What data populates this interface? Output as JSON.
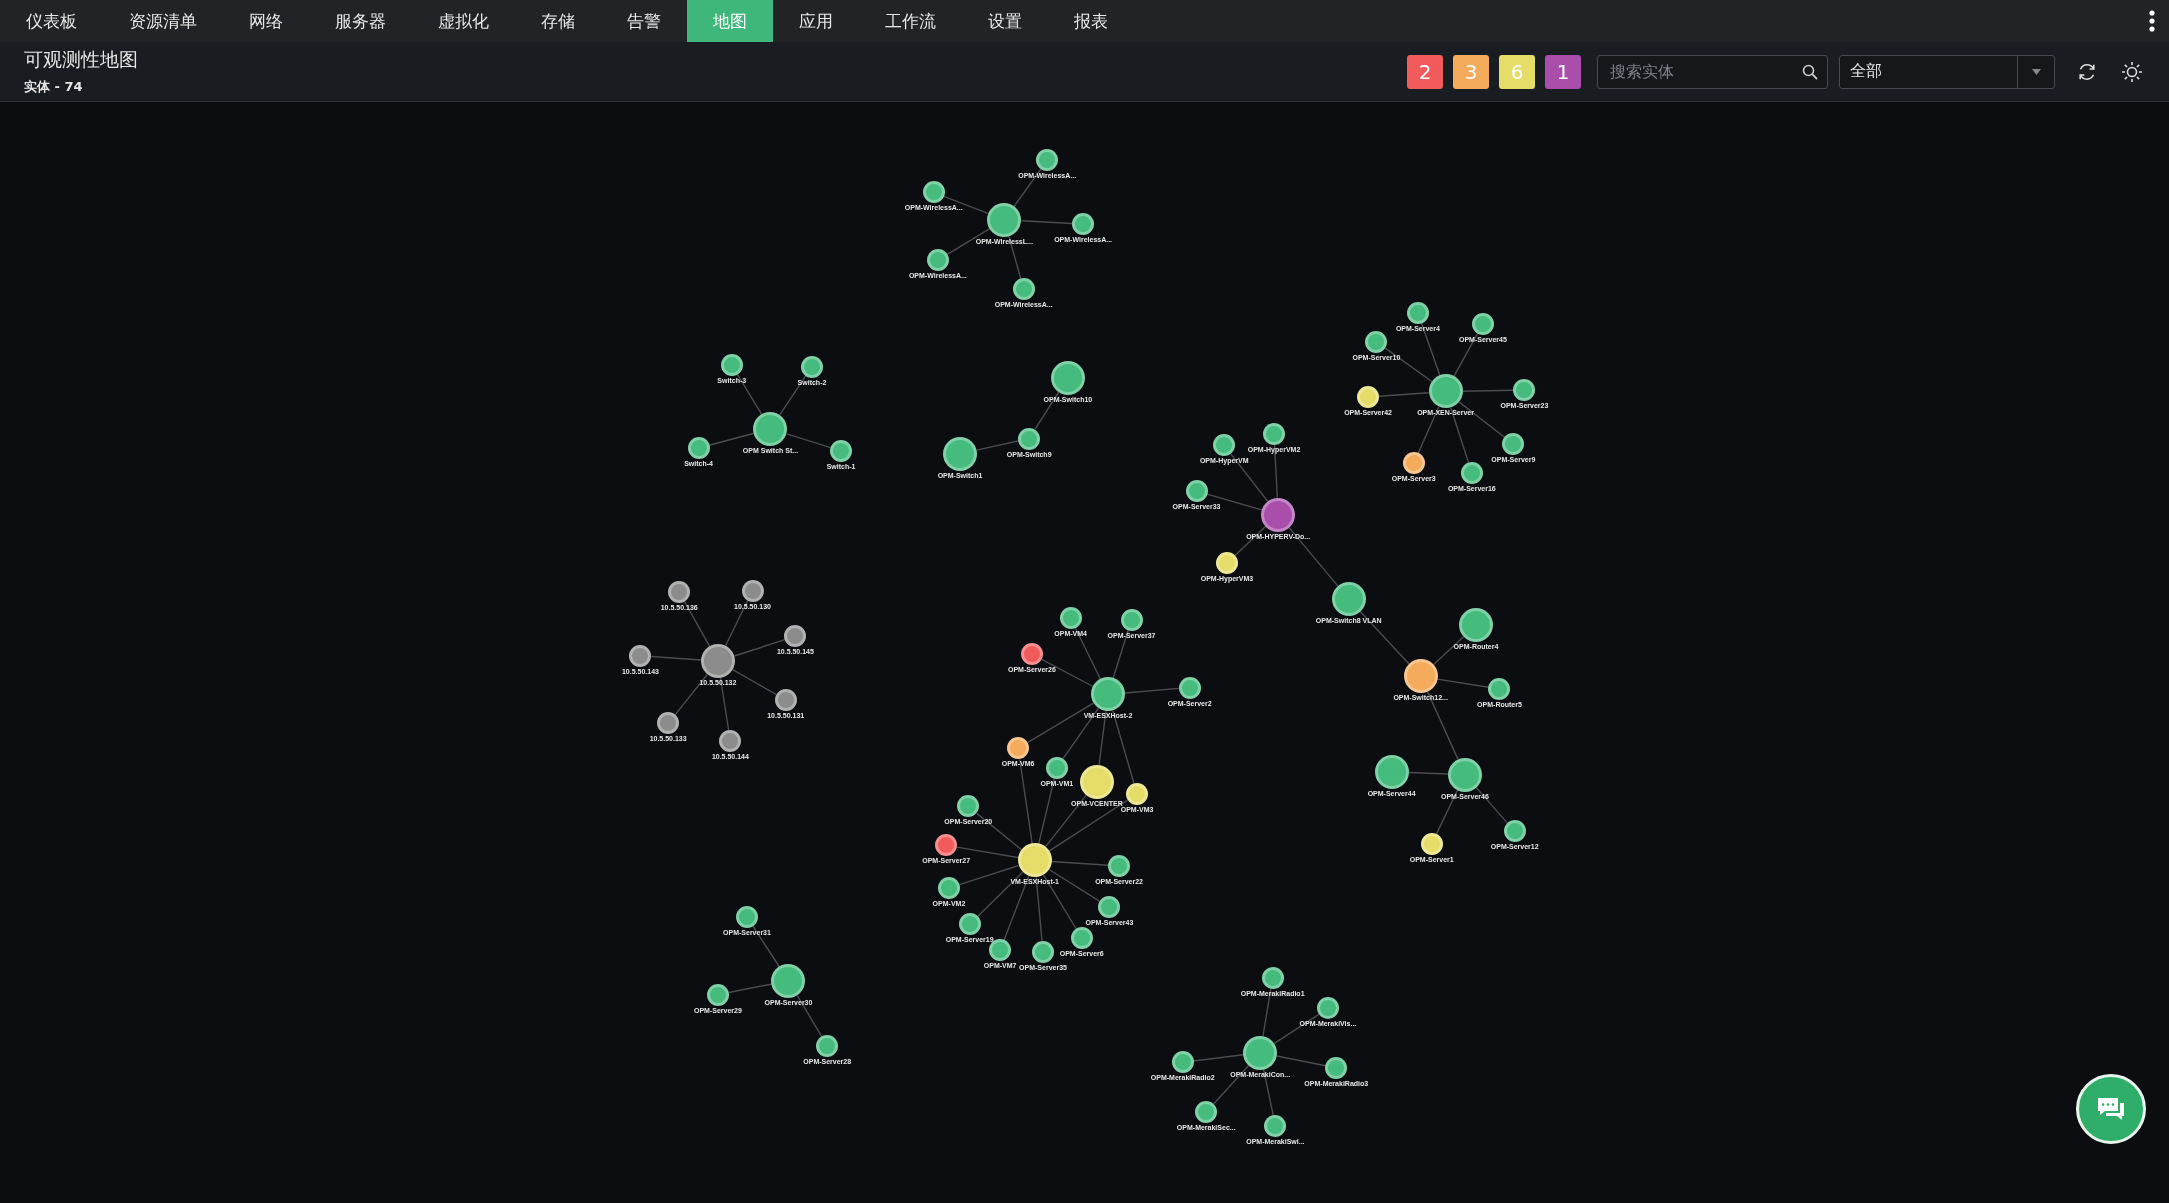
{
  "nav": {
    "tabs": [
      {
        "label": "仪表板",
        "selected": false
      },
      {
        "label": "资源清单",
        "selected": false
      },
      {
        "label": "网络",
        "selected": false
      },
      {
        "label": "服务器",
        "selected": false
      },
      {
        "label": "虚拟化",
        "selected": false
      },
      {
        "label": "存储",
        "selected": false
      },
      {
        "label": "告警",
        "selected": false
      },
      {
        "label": "地图",
        "selected": true
      },
      {
        "label": "应用",
        "selected": false
      },
      {
        "label": "工作流",
        "selected": false
      },
      {
        "label": "设置",
        "selected": false
      },
      {
        "label": "报表",
        "selected": false
      }
    ]
  },
  "header": {
    "title": "可观测性地图",
    "subtitle": "实体 - 74",
    "badges": [
      {
        "count": "2",
        "color": "#f25b5b"
      },
      {
        "count": "3",
        "color": "#f5ab5c"
      },
      {
        "count": "6",
        "color": "#e5dd68"
      },
      {
        "count": "1",
        "color": "#a94eab"
      }
    ],
    "search": {
      "placeholder": "搜索实体"
    },
    "filter": {
      "value": "全部"
    }
  },
  "map": {
    "nodes": [
      {
        "label": "OPM-WirelessA...",
        "color": "#45bb7e"
      },
      {
        "label": "OPM-WirelessA...",
        "color": "#45bb7e"
      },
      {
        "label": "OPM-WirelessL...",
        "color": "#45bb7e"
      },
      {
        "label": "OPM-WirelessA...",
        "color": "#45bb7e"
      },
      {
        "label": "OPM-WirelessA...",
        "color": "#45bb7e"
      },
      {
        "label": "OPM-WirelessA...",
        "color": "#45bb7e"
      },
      {
        "label": "OPM-Server4",
        "color": "#45bb7e"
      },
      {
        "label": "OPM-Server45",
        "color": "#45bb7e"
      },
      {
        "label": "OPM-Server10",
        "color": "#45bb7e"
      },
      {
        "label": "Switch-3",
        "color": "#45bb7e"
      },
      {
        "label": "Switch-2",
        "color": "#45bb7e"
      },
      {
        "label": "OPM-Switch10",
        "color": "#45bb7e"
      },
      {
        "label": "OPM-Server23",
        "color": "#45bb7e"
      },
      {
        "label": "OPM-XEN-Server",
        "color": "#45bb7e"
      },
      {
        "label": "OPM-Server42",
        "color": "#e5dd68"
      },
      {
        "label": "Switch-4",
        "color": "#45bb7e"
      },
      {
        "label": "OPM Switch St...",
        "color": "#45bb7e"
      },
      {
        "label": "Switch-1",
        "color": "#45bb7e"
      },
      {
        "label": "OPM-Switch1",
        "color": "#45bb7e"
      },
      {
        "label": "OPM-Switch9",
        "color": "#45bb7e"
      },
      {
        "label": "OPM-HyperVM",
        "color": "#45bb7e"
      },
      {
        "label": "OPM-HyperVM2",
        "color": "#45bb7e"
      },
      {
        "label": "OPM-Server9",
        "color": "#45bb7e"
      },
      {
        "label": "OPM-Server3",
        "color": "#f5ab5c"
      },
      {
        "label": "OPM-Server16",
        "color": "#45bb7e"
      },
      {
        "label": "OPM-Server33",
        "color": "#45bb7e"
      },
      {
        "label": "OPM-HYPERV-Do...",
        "color": "#a94eab"
      },
      {
        "label": "OPM-HyperVM3",
        "color": "#e5dd68"
      },
      {
        "label": "10.5.50.130",
        "color": "#8c8c8c"
      },
      {
        "label": "10.5.50.136",
        "color": "#8c8c8c"
      },
      {
        "label": "OPM-Switch8 VLAN",
        "color": "#45bb7e"
      },
      {
        "label": "OPM-VM4",
        "color": "#45bb7e"
      },
      {
        "label": "OPM-Server37",
        "color": "#45bb7e"
      },
      {
        "label": "OPM-Router4",
        "color": "#45bb7e"
      },
      {
        "label": "10.5.50.145",
        "color": "#8c8c8c"
      },
      {
        "label": "OPM-Server26",
        "color": "#f25b5b"
      },
      {
        "label": "10.5.50.143",
        "color": "#8c8c8c"
      },
      {
        "label": "10.5.50.132",
        "color": "#8c8c8c"
      },
      {
        "label": "OPM-Switch12...",
        "color": "#f5ab5c"
      },
      {
        "label": "OPM-Server2",
        "color": "#45bb7e"
      },
      {
        "label": "OPM-Router5",
        "color": "#45bb7e"
      },
      {
        "label": "VM-ESXHost-2",
        "color": "#45bb7e"
      },
      {
        "label": "10.5.50.131",
        "color": "#8c8c8c"
      },
      {
        "label": "10.5.50.133",
        "color": "#8c8c8c"
      },
      {
        "label": "10.5.50.144",
        "color": "#8c8c8c"
      },
      {
        "label": "OPM-VM6",
        "color": "#f5ab5c"
      },
      {
        "label": "OPM-VM1",
        "color": "#45bb7e"
      },
      {
        "label": "OPM-Server44",
        "color": "#45bb7e"
      },
      {
        "label": "OPM-Server46",
        "color": "#45bb7e"
      },
      {
        "label": "OPM-VCENTER",
        "color": "#e5dd68"
      },
      {
        "label": "OPM-VM3",
        "color": "#e5dd68"
      },
      {
        "label": "OPM-Server20",
        "color": "#45bb7e"
      },
      {
        "label": "OPM-Server12",
        "color": "#45bb7e"
      },
      {
        "label": "OPM-Server1",
        "color": "#e5dd68"
      },
      {
        "label": "OPM-Server27",
        "color": "#f25b5b"
      },
      {
        "label": "VM-ESXHost-1",
        "color": "#e5dd68"
      },
      {
        "label": "OPM-Server22",
        "color": "#45bb7e"
      },
      {
        "label": "OPM-VM2",
        "color": "#45bb7e"
      },
      {
        "label": "OPM-Server43",
        "color": "#45bb7e"
      },
      {
        "label": "OPM-Server31",
        "color": "#45bb7e"
      },
      {
        "label": "OPM-Server19",
        "color": "#45bb7e"
      },
      {
        "label": "OPM-Server6",
        "color": "#45bb7e"
      },
      {
        "label": "OPM-VM7",
        "color": "#45bb7e"
      },
      {
        "label": "OPM-Server35",
        "color": "#45bb7e"
      },
      {
        "label": "OPM-MerakiRadio1",
        "color": "#45bb7e"
      },
      {
        "label": "OPM-Server30",
        "color": "#45bb7e"
      },
      {
        "label": "OPM-Server29",
        "color": "#45bb7e"
      },
      {
        "label": "OPM-MerakiVis...",
        "color": "#45bb7e"
      },
      {
        "label": "OPM-Server28",
        "color": "#45bb7e"
      },
      {
        "label": "OPM-MerakiCon...",
        "color": "#45bb7e"
      },
      {
        "label": "OPM-MerakiRadio2",
        "color": "#45bb7e"
      },
      {
        "label": "OPM-MerakiRadio3",
        "color": "#45bb7e"
      },
      {
        "label": "OPM-MerakiSec...",
        "color": "#45bb7e"
      },
      {
        "label": "OPM-MerakiSwi...",
        "color": "#45bb7e"
      }
    ]
  }
}
